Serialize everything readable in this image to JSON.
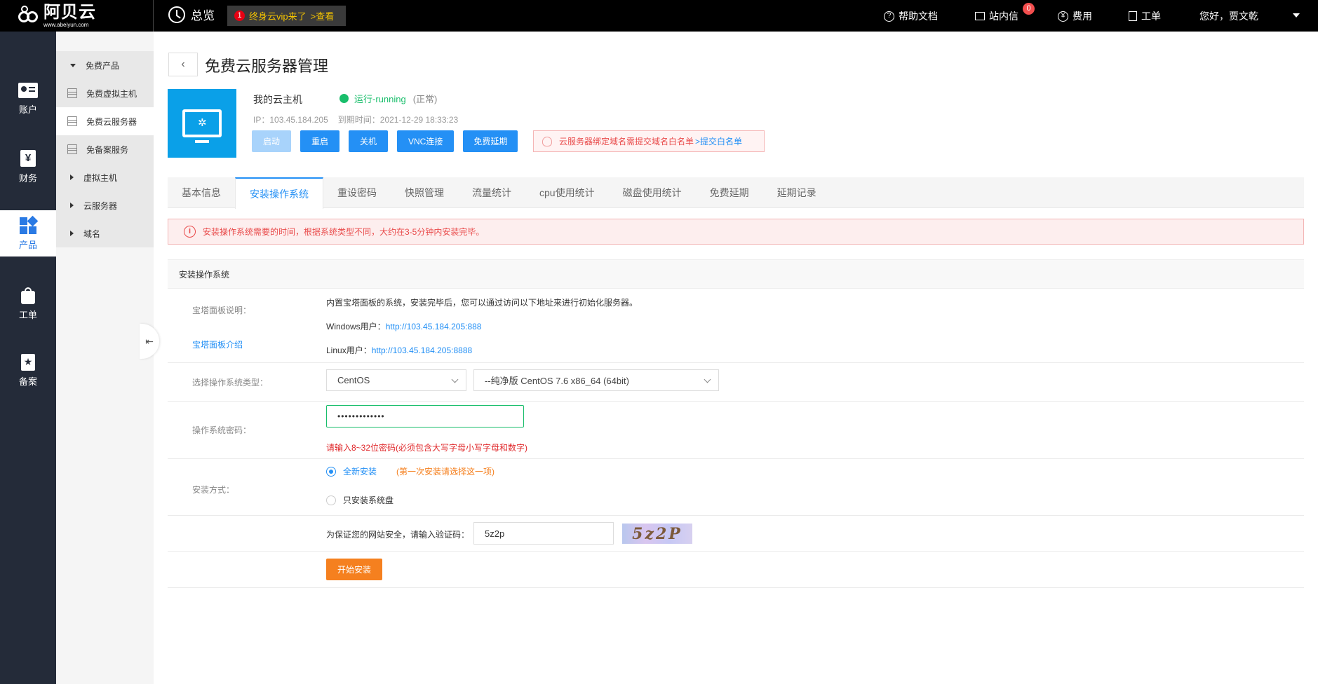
{
  "topbar": {
    "logo_text": "阿贝云",
    "logo_domain": "www.abeiyun.com",
    "overview": "总览",
    "promo": {
      "count": "1",
      "text": "终身云vip来了",
      "link": ">查看"
    },
    "help": "帮助文档",
    "messages": "站内信",
    "message_count": "0",
    "fees": "费用",
    "tickets": "工单",
    "greeting": "您好，贾文乾"
  },
  "leftnav": {
    "items": [
      {
        "label": "账户",
        "icon": "id-card-icon"
      },
      {
        "label": "财务",
        "icon": "yen-icon"
      },
      {
        "label": "产品",
        "icon": "grid-icon",
        "active": true
      },
      {
        "label": "工单",
        "icon": "bag-icon"
      },
      {
        "label": "备案",
        "icon": "star-icon"
      }
    ]
  },
  "subnav": {
    "free_group": "免费产品",
    "items": [
      {
        "label": "免费虚拟主机"
      },
      {
        "label": "免费云服务器",
        "selected": true
      },
      {
        "label": "免备案服务"
      }
    ],
    "groups": [
      "虚拟主机",
      "云服务器",
      "域名"
    ]
  },
  "main": {
    "title": "免费云服务器管理",
    "host": {
      "name": "我的云主机",
      "status": "运行-running",
      "status_note": "(正常)",
      "ip_label": "IP：",
      "ip": "103.45.184.205",
      "expire_label": "到期时间：",
      "expire": "2021-12-29 18:33:23"
    },
    "buttons": {
      "start": "启动",
      "restart": "重启",
      "shutdown": "关机",
      "vnc": "VNC连接",
      "extend": "免费延期"
    },
    "notice": {
      "text": "云服务器绑定域名需提交域名白名单",
      "link": ">提交白名单"
    },
    "tabs": [
      "基本信息",
      "安装操作系统",
      "重设密码",
      "快照管理",
      "流量统计",
      "cpu使用统计",
      "磁盘使用统计",
      "免费延期",
      "延期记录"
    ],
    "active_tab": 1,
    "alert": "安装操作系统需要的时间，根据系统类型不同，大约在3-5分钟内安装完毕。",
    "section_title": "安装操作系统",
    "panel": {
      "label": "宝塔面板说明：",
      "intro_link": "宝塔面板介绍",
      "desc": "内置宝塔面板的系统，安装完毕后，您可以通过访问以下地址来进行初始化服务器。",
      "windows_label": "Windows用户：",
      "windows_url": "http://103.45.184.205:888",
      "linux_label": "Linux用户：",
      "linux_url": "http://103.45.184.205:8888"
    },
    "os": {
      "label": "选择操作系统类型：",
      "type": "CentOS",
      "version": "--纯净版 CentOS 7.6  x86_64 (64bit)"
    },
    "password": {
      "label": "操作系统密码：",
      "value": "•••••••••••••",
      "hint": "请输入8~32位密码(必须包含大写字母小写字母和数字)"
    },
    "install_mode": {
      "label": "安装方式：",
      "full": "全新安装",
      "full_note": "(第一次安装请选择这一项)",
      "system_only": "只安装系统盘"
    },
    "captcha": {
      "label": "为保证您的网站安全，请输入验证码：",
      "value": "5z2p",
      "image_text": "5z2P"
    },
    "submit": "开始安装"
  },
  "colors": {
    "primary": "#2490f5",
    "success": "#19be6b",
    "danger": "#e94b4b",
    "orange": "#f5801f",
    "nav_dark": "#242b39"
  }
}
